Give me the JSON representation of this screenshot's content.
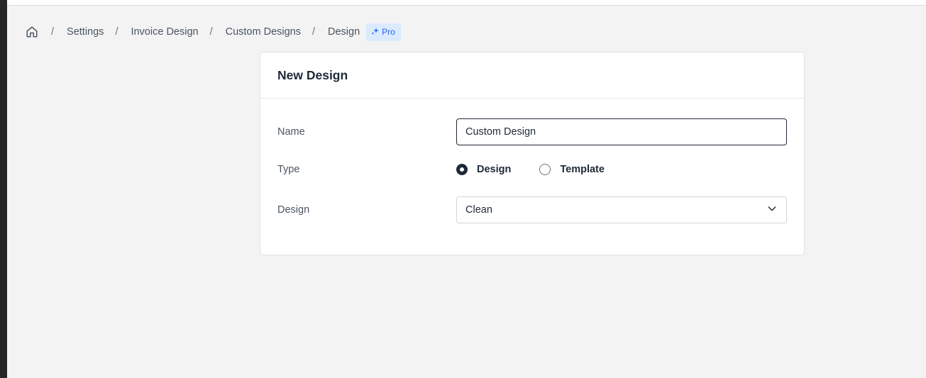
{
  "breadcrumb": {
    "home_icon": "home-icon",
    "separator": "/",
    "items": [
      "Settings",
      "Invoice Design",
      "Custom Designs",
      "Design"
    ],
    "badge": {
      "label": "Pro",
      "icon": "sparkle-icon",
      "color": "#2563eb",
      "background": "#dbeafe"
    }
  },
  "card": {
    "title": "New Design",
    "name_field": {
      "label": "Name",
      "value": "Custom Design"
    },
    "type_field": {
      "label": "Type",
      "options": [
        {
          "label": "Design",
          "checked": true
        },
        {
          "label": "Template",
          "checked": false
        }
      ]
    },
    "design_field": {
      "label": "Design",
      "selected": "Clean",
      "icon": "chevron-down-icon"
    }
  }
}
